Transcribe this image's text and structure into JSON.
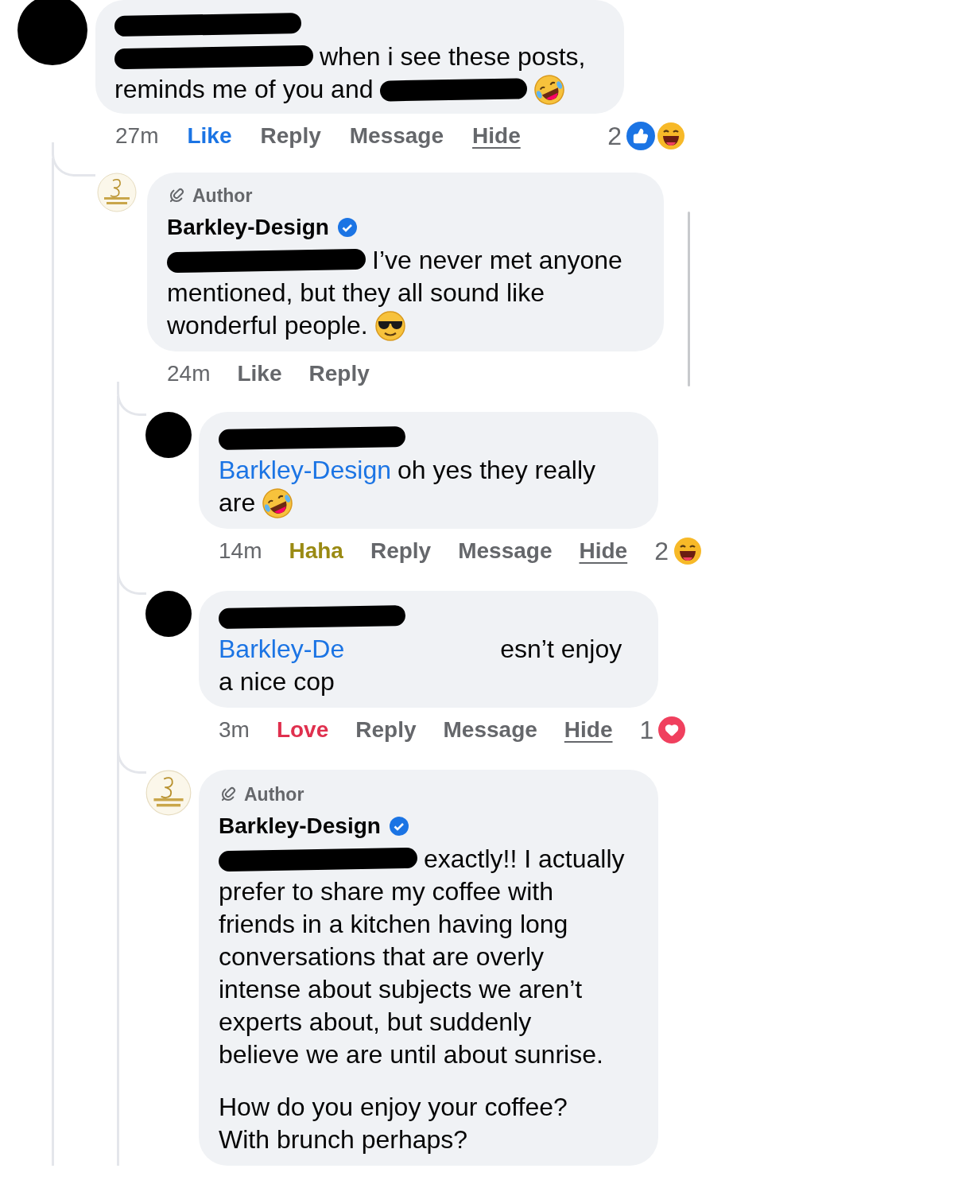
{
  "comments": [
    {
      "avatar": {
        "kind": "redacted"
      },
      "paragraphs": [
        [
          [
            {
              "kind": "redaction"
            }
          ],
          [
            {
              "kind": "redaction"
            },
            {
              "kind": "text",
              "text": "when i see these posts,"
            }
          ],
          [
            {
              "kind": "text",
              "text": "reminds me of you and"
            },
            {
              "kind": "redaction"
            },
            {
              "kind": "rofl"
            }
          ]
        ]
      ],
      "actions": [
        {
          "kind": "time",
          "label": "27m"
        },
        {
          "kind": "like",
          "label": "Like",
          "selected": true
        },
        {
          "kind": "plain",
          "label": "Reply"
        },
        {
          "kind": "plain",
          "label": "Message"
        },
        {
          "kind": "underlined",
          "label": "Hide"
        }
      ],
      "reactions": {
        "count": "2",
        "icons": [
          {
            "kind": "like"
          },
          {
            "kind": "haha"
          }
        ]
      },
      "replies": [
        {
          "avatar": {
            "kind": "picture"
          },
          "badge": "Author",
          "name": "Barkley-Design",
          "verified": true,
          "paragraphs": [
            [
              [
                {
                  "kind": "redaction"
                },
                {
                  "kind": "text",
                  "text": "I’ve never met anyone"
                }
              ],
              [
                {
                  "kind": "text",
                  "text": "mentioned, but they all sound like"
                }
              ],
              [
                {
                  "kind": "text",
                  "text": "wonderful people."
                },
                {
                  "kind": "sunglasses"
                }
              ]
            ]
          ],
          "actions": [
            {
              "kind": "time",
              "label": "24m"
            },
            {
              "kind": "like",
              "label": "Like",
              "selected": false
            },
            {
              "kind": "plain",
              "label": "Reply"
            }
          ],
          "replies": [
            {
              "avatar": {
                "kind": "redacted"
              },
              "paragraphs": [
                [
                  [
                    {
                      "kind": "redaction"
                    }
                  ],
                  [
                    {
                      "kind": "mention",
                      "text": "Barkley-Design"
                    },
                    {
                      "kind": "text",
                      "text": "oh yes they really"
                    }
                  ],
                  [
                    {
                      "kind": "text",
                      "text": "are"
                    },
                    {
                      "kind": "rofl"
                    }
                  ]
                ]
              ],
              "actions": [
                {
                  "kind": "time",
                  "label": "14m"
                },
                {
                  "kind": "haha",
                  "label": "Haha",
                  "selected": true
                },
                {
                  "kind": "plain",
                  "label": "Reply"
                },
                {
                  "kind": "plain",
                  "label": "Message"
                },
                {
                  "kind": "underlined",
                  "label": "Hide"
                }
              ],
              "reactions": {
                "count": "2",
                "icons": [
                  {
                    "kind": "haha"
                  }
                ]
              }
            },
            {
              "avatar": {
                "kind": "redacted"
              },
              "paragraphs": [
                [
                  [
                    {
                      "kind": "redaction"
                    }
                  ],
                  [
                    {
                      "kind": "mention",
                      "text": "Barkley-De"
                    },
                    {
                      "kind": "gap"
                    },
                    {
                      "kind": "text",
                      "text": "esn’t enjoy"
                    }
                  ],
                  [
                    {
                      "kind": "text",
                      "text": "a nice cop"
                    }
                  ]
                ]
              ],
              "actions": [
                {
                  "kind": "time",
                  "label": "3m"
                },
                {
                  "kind": "love",
                  "label": "Love",
                  "selected": true
                },
                {
                  "kind": "plain",
                  "label": "Reply"
                },
                {
                  "kind": "plain",
                  "label": "Message"
                },
                {
                  "kind": "underlined",
                  "label": "Hide"
                }
              ],
              "reactions": {
                "count": "1",
                "icons": [
                  {
                    "kind": "love"
                  }
                ]
              }
            },
            {
              "avatar": {
                "kind": "picture"
              },
              "badge": "Author",
              "name": "Barkley-Design",
              "verified": true,
              "paragraphs": [
                [
                  [
                    {
                      "kind": "redaction"
                    },
                    {
                      "kind": "text",
                      "text": "exactly!! I actually"
                    }
                  ],
                  [
                    {
                      "kind": "text",
                      "text": "prefer to share my coffee with"
                    }
                  ],
                  [
                    {
                      "kind": "text",
                      "text": "friends in a kitchen having long"
                    }
                  ],
                  [
                    {
                      "kind": "text",
                      "text": "conversations that are overly"
                    }
                  ],
                  [
                    {
                      "kind": "text",
                      "text": "intense about subjects we aren’t"
                    }
                  ],
                  [
                    {
                      "kind": "text",
                      "text": "experts about, but suddenly"
                    }
                  ],
                  [
                    {
                      "kind": "text",
                      "text": "believe we are until about sunrise."
                    }
                  ]
                ],
                [
                  [
                    {
                      "kind": "text",
                      "text": "How do you enjoy your coffee?"
                    }
                  ],
                  [
                    {
                      "kind": "text",
                      "text": "With brunch perhaps?"
                    }
                  ]
                ]
              ]
            }
          ]
        }
      ]
    }
  ]
}
